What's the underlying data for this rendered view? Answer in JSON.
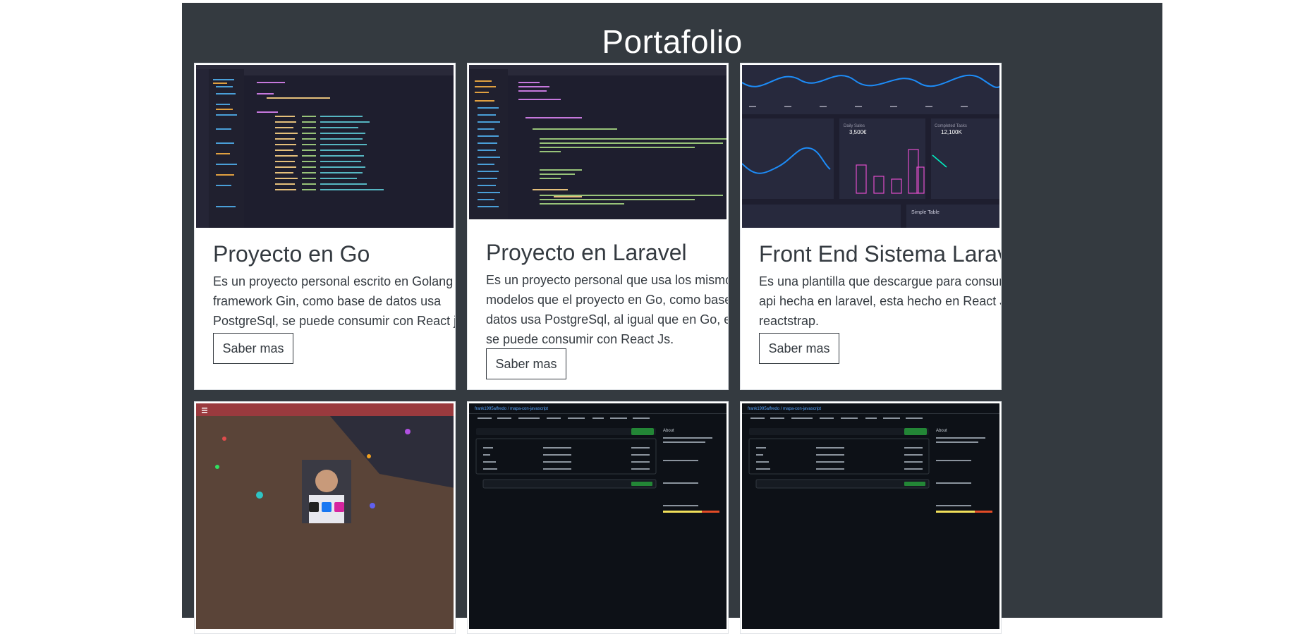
{
  "section": {
    "title": "Portafolio"
  },
  "cards": [
    {
      "title": "Proyecto en Go",
      "text": "Es un proyecto personal escrito en Golang con el framework Gin, como base de datos usa PostgreSql, se puede consumir con React js.",
      "button": "Saber mas",
      "image": "vscode-go-screenshot"
    },
    {
      "title": "Proyecto en Laravel",
      "text": "Es un proyecto personal que usa los mismos modelos que el proyecto en Go, como base de datos usa PostgreSql, al igual que en Go, este se puede consumir con React Js.",
      "button": "Saber mas",
      "image": "vscode-laravel-screenshot"
    },
    {
      "title": "Front End Sistema Laravel",
      "text": "Es una plantilla que descargue para consumir la api hecha en laravel, esta hecho en React Js y reactstrap.",
      "button": "Saber mas",
      "image": "dashboard-screenshot",
      "image_text": {
        "daily_sales": "Daily Sales",
        "daily_value": "3,500€",
        "completed": "Completed Tasks",
        "completed_value": "12,100K",
        "simple_table": "Simple Table"
      }
    },
    {
      "image": "personal-site-screenshot"
    },
    {
      "image": "github-repo-screenshot",
      "image_text": {
        "repo": "frank1995alfredo / mapa-con-javascript",
        "about": "About"
      }
    },
    {
      "image": "github-repo-screenshot",
      "image_text": {
        "repo": "frank1995alfredo / mapa-con-javascript",
        "about": "About"
      }
    }
  ],
  "colors": {
    "section_bg": "#343a40",
    "card_bg": "#ffffff",
    "text": "#343a40"
  }
}
